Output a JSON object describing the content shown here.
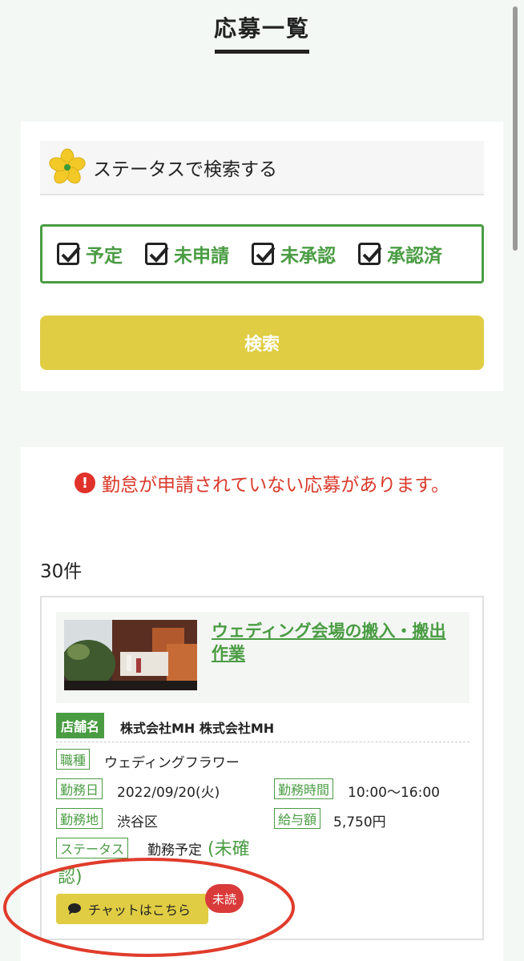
{
  "page": {
    "title": "応募一覧"
  },
  "search": {
    "header_label": "ステータスで検索する",
    "header_icon": "flower-logo-icon",
    "statuses": [
      {
        "label": "予定",
        "checked": true
      },
      {
        "label": "未申請",
        "checked": true
      },
      {
        "label": "未承認",
        "checked": true
      },
      {
        "label": "承認済",
        "checked": true
      }
    ],
    "button_label": "検索"
  },
  "results": {
    "alert_text": "勤怠が申請されていない応募があります。",
    "alert_icon": "exclamation-circle-icon",
    "count_text": "30件",
    "job": {
      "title": "ウェディング会場の搬入・搬出作業",
      "shop_tag": "店舗名",
      "shop_name": "株式会社MH 株式会社MH",
      "job_type_tag": "職種",
      "job_type": "ウェディングフラワー",
      "work_date_tag": "勤務日",
      "work_date": "2022/09/20(火)",
      "work_time_tag": "勤務時間",
      "work_time": "10:00〜16:00",
      "location_tag": "勤務地",
      "location": "渋谷区",
      "salary_tag": "給与額",
      "salary": "5,750円",
      "status_tag": "ステータス",
      "status": "勤務予定",
      "status_note": "(未確認)",
      "chat_label": "チャットはこちら",
      "chat_icon": "speech-bubble-icon",
      "unread_badge": "未読"
    }
  },
  "colors": {
    "accent_green": "#4a9c43",
    "button_yellow": "#e0cd44",
    "alert_red": "#d93a2b",
    "annotation_red": "#e03c2c"
  }
}
